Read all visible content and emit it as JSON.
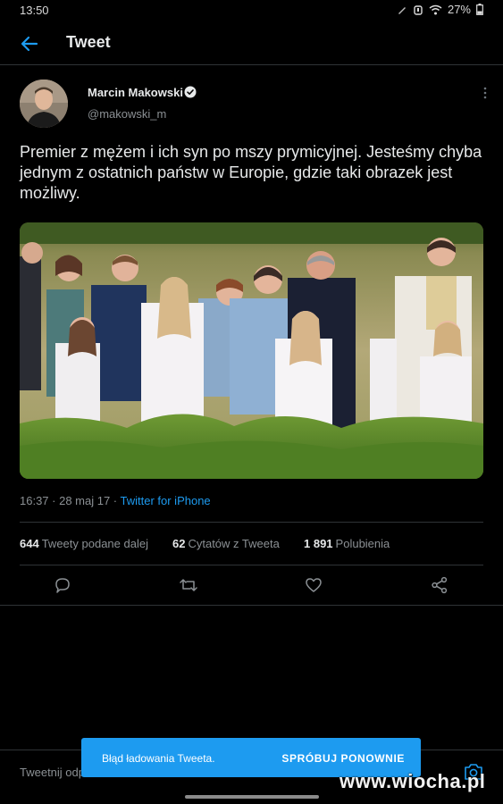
{
  "status_bar": {
    "time": "13:50",
    "battery": "27%",
    "icons": [
      "pen-icon",
      "alarm-icon",
      "wifi-icon",
      "battery-icon"
    ]
  },
  "header": {
    "title": "Tweet",
    "back_icon": "arrow-left-icon"
  },
  "tweet": {
    "author_name": "Marcin Makowski",
    "author_handle": "@makowski_m",
    "text": "Premier z mężem i ich syn po mszy prymicyjnej. Jesteśmy chyba jednym z ostatnich państw w Europie, gdzie taki obrazek jest możliwy.",
    "timestamp": "16:37 · 28 maj 17 · ",
    "source": "Twitter for iPhone",
    "photo_description": "group-photo"
  },
  "stats": {
    "retweets_count": "644",
    "retweets_label": "Tweety podane dalej",
    "quotes_count": "62",
    "quotes_label": "Cytatów z Tweeta",
    "likes_count": "1 891",
    "likes_label": "Polubienia"
  },
  "composer": {
    "placeholder": "Tweetnij odp"
  },
  "toast": {
    "message": "Błąd ładowania Tweeta.",
    "action": "SPRÓBUJ PONOWNIE"
  },
  "watermark": "www.wiocha.pl",
  "colors": {
    "accent": "#1d9bf0",
    "background": "#000000",
    "secondary_text": "#8b9094"
  }
}
